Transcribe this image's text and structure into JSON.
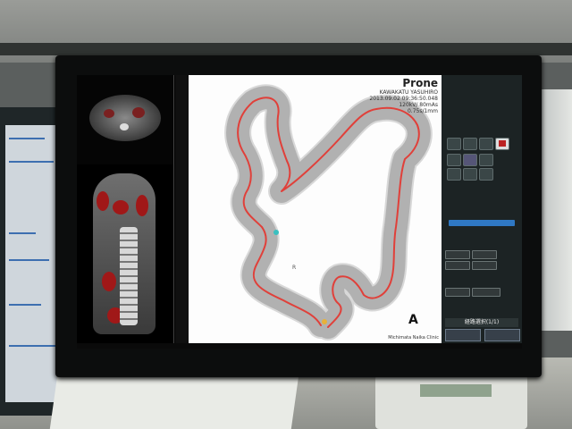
{
  "view": {
    "orientation": "Prone",
    "patient": "KAWAKATU YASUHIRO",
    "datetime": "2013.09.02 09:36:50.048",
    "dose": "120kV/ 80mAs",
    "slice": "0.75s/1mm",
    "marker": "A",
    "r_label": "R",
    "clinic": "Michimata Naika Clinic"
  },
  "panel": {
    "route_label": "経路選択(1/1)"
  },
  "colors": {
    "colon_outline": "#555555",
    "lumen_path": "#e0403a",
    "panel_bg": "#1c2324",
    "accent_blue": "#2f78c4"
  }
}
